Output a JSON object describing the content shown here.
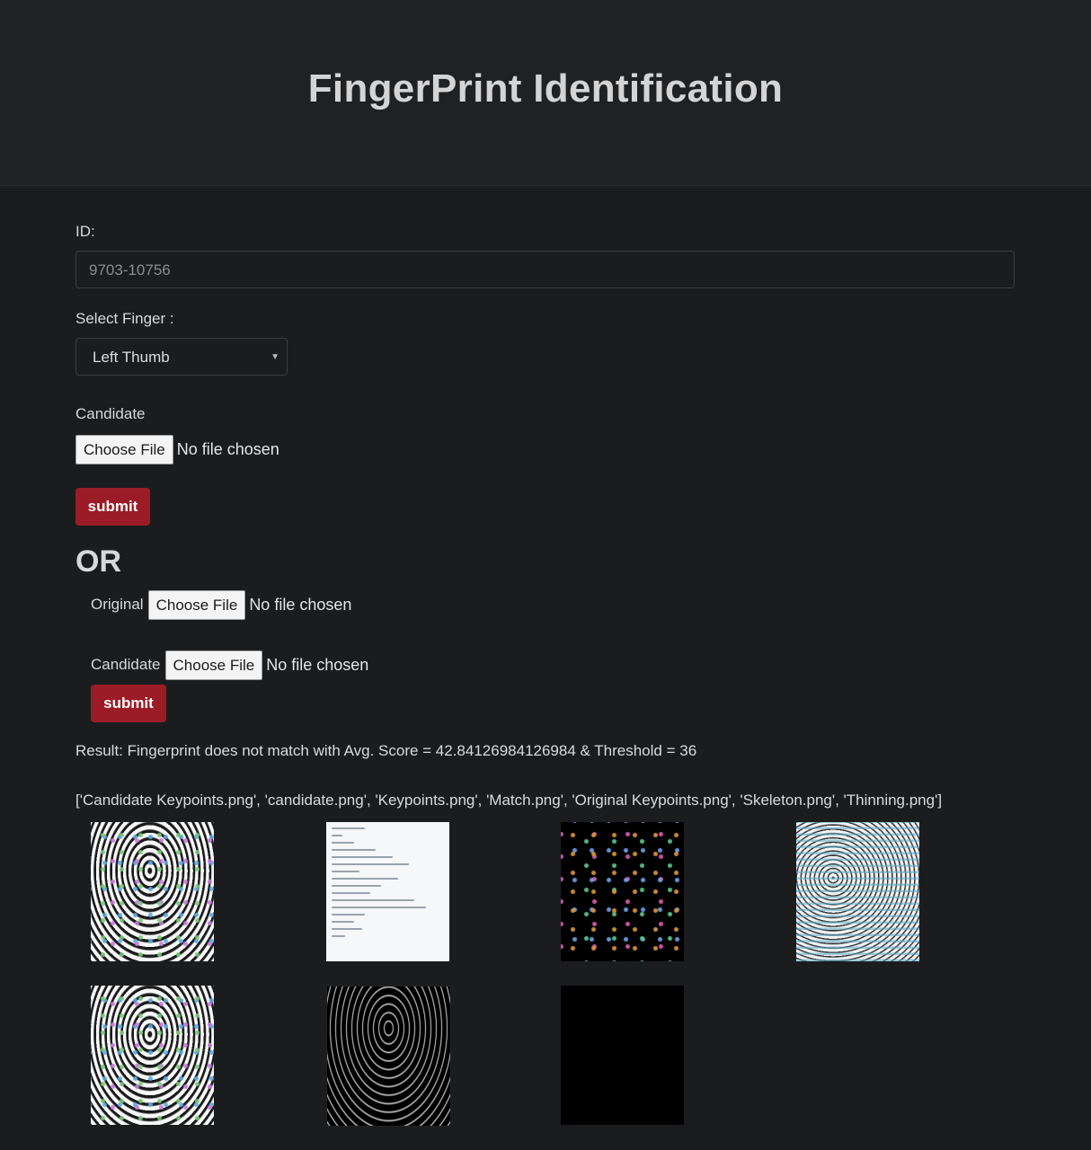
{
  "header": {
    "title": "FingerPrint Identification"
  },
  "form1": {
    "id_label": "ID:",
    "id_placeholder": "9703-10756",
    "finger_label": "Select Finger :",
    "finger_selected": "Left Thumb",
    "candidate_label": "Candidate",
    "choose_file": "Choose File",
    "no_file": "No file chosen",
    "submit_label": "submit"
  },
  "or_label": "OR",
  "form2": {
    "original_label": "Original",
    "candidate_label": "Candidate",
    "choose_file": "Choose File",
    "no_file": "No file chosen",
    "submit_label": "submit"
  },
  "result": {
    "text": "Result: Fingerprint does not match with Avg. Score = 42.84126984126984 & Threshold = 36",
    "files_list": "['Candidate Keypoints.png', 'candidate.png', 'Keypoints.png', 'Match.png', 'Original Keypoints.png', 'Skeleton.png', 'Thinning.png']"
  },
  "images": [
    {
      "name": "Candidate Keypoints.png"
    },
    {
      "name": "candidate.png"
    },
    {
      "name": "Keypoints.png"
    },
    {
      "name": "Match.png"
    },
    {
      "name": "Original Keypoints.png"
    },
    {
      "name": "Skeleton.png"
    },
    {
      "name": "Thinning.png"
    }
  ]
}
